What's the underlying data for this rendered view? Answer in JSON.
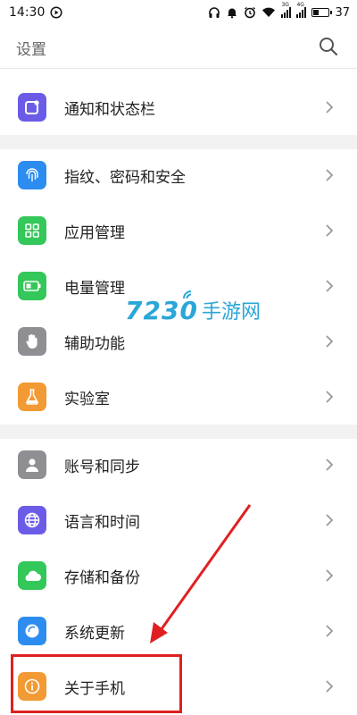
{
  "status_bar": {
    "time": "14:30",
    "battery_level": "37",
    "net1": "3G",
    "net2": "4G",
    "icons": [
      "play-circle-icon",
      "headphones-icon",
      "notification-icon",
      "alarm-icon",
      "wifi-icon",
      "signal-icon",
      "signal-icon",
      "battery-icon"
    ]
  },
  "header": {
    "title": "设置",
    "search_icon": "search-icon"
  },
  "settings": [
    {
      "label": "通知和状态栏",
      "icon": "notification-bar-icon",
      "color": "#6b5ce7"
    },
    {
      "label": "指纹、密码和安全",
      "icon": "fingerprint-icon",
      "color": "#2d8cf0"
    },
    {
      "label": "应用管理",
      "icon": "apps-grid-icon",
      "color": "#34c759"
    },
    {
      "label": "电量管理",
      "icon": "battery-icon",
      "color": "#34c759"
    },
    {
      "label": "辅助功能",
      "icon": "hand-icon",
      "color": "#8e8e93"
    },
    {
      "label": "实验室",
      "icon": "flask-icon",
      "color": "#f29a33"
    },
    {
      "label": "账号和同步",
      "icon": "user-icon",
      "color": "#8e8e93"
    },
    {
      "label": "语言和时间",
      "icon": "globe-icon",
      "color": "#6b5ce7"
    },
    {
      "label": "存储和备份",
      "icon": "cloud-icon",
      "color": "#34c759"
    },
    {
      "label": "系统更新",
      "icon": "update-icon",
      "color": "#2d8cf0"
    },
    {
      "label": "关于手机",
      "icon": "info-icon",
      "color": "#f29a33"
    }
  ],
  "watermark": {
    "number": "7230",
    "text": "手游网",
    "color": "#2aa6d8"
  },
  "annotation": {
    "color": "#e02020"
  }
}
